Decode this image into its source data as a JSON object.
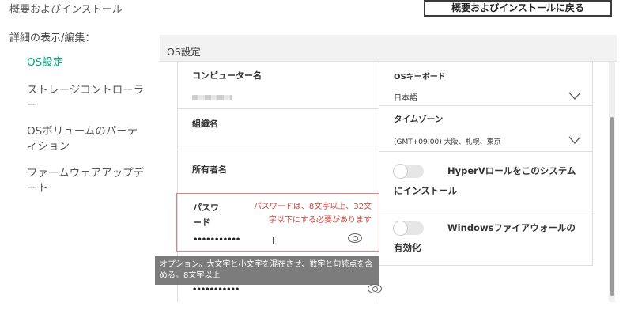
{
  "breadcrumb": "概要およびインストール",
  "back_button": "概要およびインストールに戻る",
  "sidebar": {
    "title": "詳細の表示/編集：",
    "items": [
      {
        "label": "OS設定",
        "active": true
      },
      {
        "label": "ストレージコントローラー",
        "active": false
      },
      {
        "label": "OSボリュームのパーティション",
        "active": false
      },
      {
        "label": "ファームウェアアップデート",
        "active": false
      }
    ]
  },
  "panel": {
    "title": "OS設定",
    "left": {
      "computer_name_label": "コンピューター名",
      "org_name_label": "組織名",
      "owner_name_label": "所有者名",
      "password_label": "パスワード",
      "password_error": "パスワードは、8文字以上、32文字以下にする必要があります",
      "password_value": "•••••••••••",
      "password_confirm_value": "•••••••••••"
    },
    "right": {
      "keyboard_label": "OSキーボード",
      "keyboard_value": "日本語",
      "timezone_label": "タイムゾーン",
      "timezone_value": "(GMT+09:00) 大阪、札幌、東京",
      "hyperv_label": "HyperVロールをこのシステムにインストール",
      "firewall_label": "Windowsファイアウォールの有効化"
    }
  },
  "tooltip": "オプション。大文字と小文字を混在させ、数字と句読点を含める。8文字以上",
  "colors": {
    "accent": "#01a982",
    "error": "#d6443c"
  }
}
